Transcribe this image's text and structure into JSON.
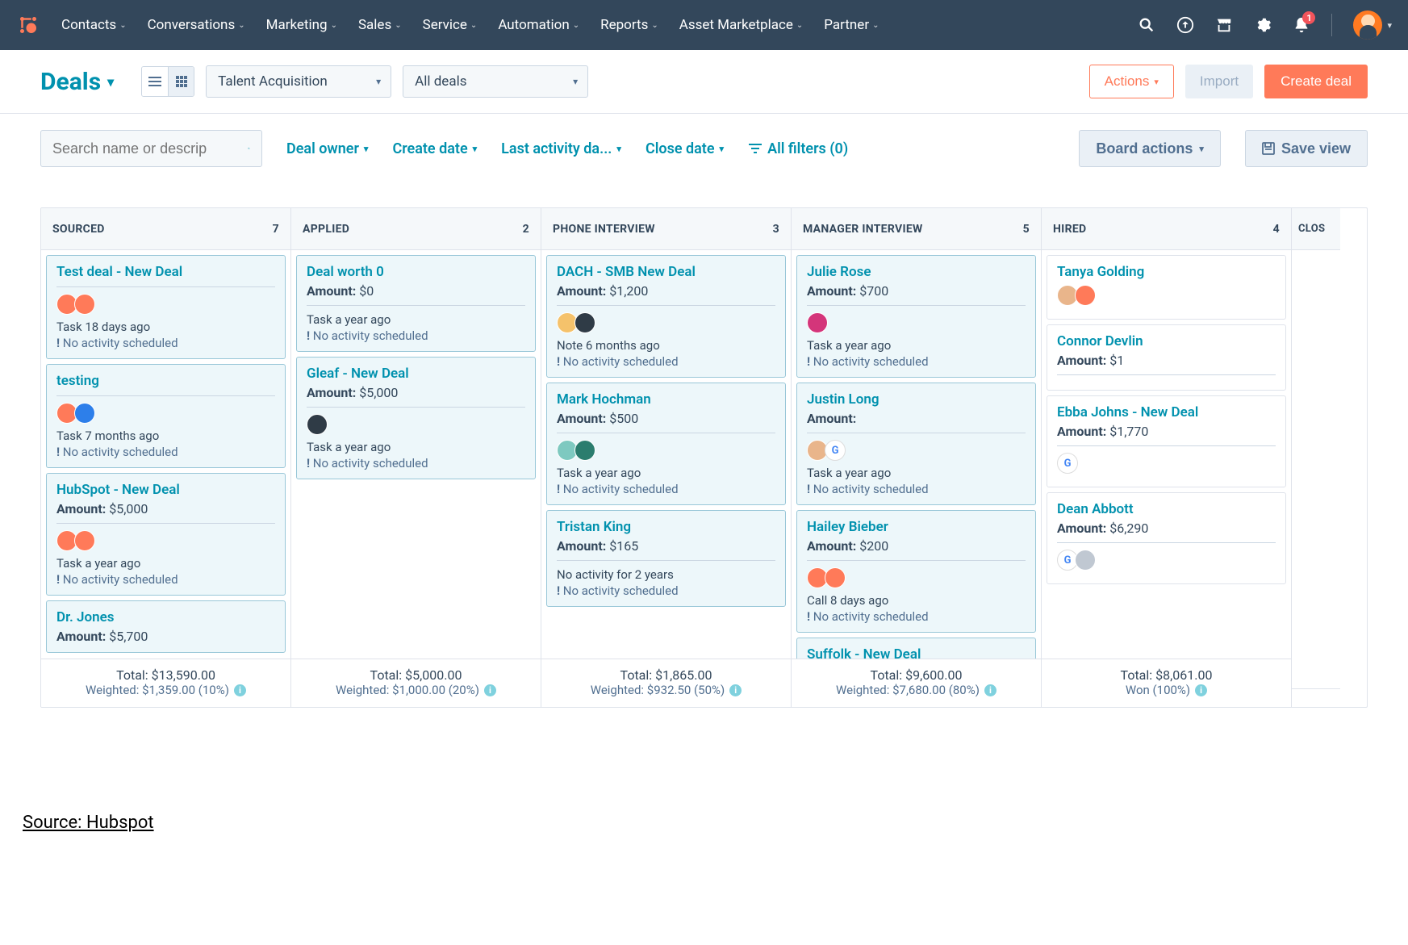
{
  "nav": {
    "items": [
      "Contacts",
      "Conversations",
      "Marketing",
      "Sales",
      "Service",
      "Automation",
      "Reports",
      "Asset Marketplace",
      "Partner"
    ],
    "notif_count": "1"
  },
  "header": {
    "title": "Deals",
    "pipeline_select": "Talent Acquisition",
    "view_select": "All deals",
    "actions_label": "Actions",
    "import_label": "Import",
    "create_label": "Create deal"
  },
  "filters": {
    "search_placeholder": "Search name or descrip",
    "owner": "Deal owner",
    "create": "Create date",
    "last": "Last activity da...",
    "close": "Close date",
    "all": "All filters (0)",
    "board_actions": "Board actions",
    "save_view": "Save view"
  },
  "columns": [
    {
      "name": "SOURCED",
      "count": "7",
      "total": "Total: $13,590.00",
      "weighted": "Weighted: $1,359.00 (10%)",
      "cards": [
        {
          "style": "blue",
          "title": "Test deal - New Deal",
          "amount": null,
          "avatars": [
            "orange",
            "orange"
          ],
          "hr_after_title": true,
          "meta": "Task 18 days ago",
          "warn": "No activity scheduled"
        },
        {
          "style": "blue",
          "title": "testing",
          "amount": null,
          "avatars": [
            "orange",
            "blue"
          ],
          "hr_after_title": true,
          "meta": "Task 7 months ago",
          "warn": "No activity scheduled"
        },
        {
          "style": "blue",
          "title": "HubSpot - New Deal",
          "amount_label": "Amount:",
          "amount": "$5,000",
          "avatars": [
            "orange",
            "orange"
          ],
          "hr": true,
          "meta": "Task a year ago",
          "warn": "No activity scheduled"
        },
        {
          "style": "blue",
          "title": "Dr. Jones",
          "amount_label": "Amount:",
          "amount": "$5,700"
        }
      ]
    },
    {
      "name": "APPLIED",
      "count": "2",
      "total": "Total: $5,000.00",
      "weighted": "Weighted: $1,000.00 (20%)",
      "cards": [
        {
          "style": "blue",
          "title": "Deal worth 0",
          "amount_label": "Amount:",
          "amount": "$0",
          "hr": true,
          "meta": "Task a year ago",
          "warn": "No activity scheduled"
        },
        {
          "style": "blue",
          "title": "Gleaf - New Deal",
          "amount_label": "Amount:",
          "amount": "$5,000",
          "avatars": [
            "dark"
          ],
          "hr": true,
          "meta": "Task a year ago",
          "warn": "No activity scheduled"
        }
      ]
    },
    {
      "name": "PHONE INTERVIEW",
      "count": "3",
      "total": "Total: $1,865.00",
      "weighted": "Weighted: $932.50 (50%)",
      "cards": [
        {
          "style": "blue",
          "title": "DACH - SMB New Deal",
          "amount_label": "Amount:",
          "amount": "$1,200",
          "avatars": [
            "yellow",
            "dark"
          ],
          "hr": true,
          "meta": "Note 6 months ago",
          "warn": "No activity scheduled"
        },
        {
          "style": "blue",
          "title": "Mark Hochman",
          "amount_label": "Amount:",
          "amount": "$500",
          "avatars": [
            "mint",
            "teal"
          ],
          "hr": true,
          "meta": "Task a year ago",
          "warn": "No activity scheduled"
        },
        {
          "style": "blue",
          "title": "Tristan King",
          "amount_label": "Amount:",
          "amount": "$165",
          "hr": true,
          "meta": "No activity for 2 years",
          "warn": "No activity scheduled"
        }
      ]
    },
    {
      "name": "MANAGER INTERVIEW",
      "count": "5",
      "total": "Total: $9,600.00",
      "weighted": "Weighted: $7,680.00 (80%)",
      "cards": [
        {
          "style": "blue",
          "title": "Julie Rose",
          "amount_label": "Amount:",
          "amount": "$700",
          "avatars": [
            "pink"
          ],
          "hr": true,
          "meta": "Task a year ago",
          "warn": "No activity scheduled"
        },
        {
          "style": "blue",
          "title": "Justin Long",
          "amount_label": "Amount:",
          "amount": null,
          "avatars": [
            "skin",
            "google"
          ],
          "hr": true,
          "meta": "Task a year ago",
          "warn": "No activity scheduled"
        },
        {
          "style": "blue",
          "title": "Hailey Bieber",
          "amount_label": "Amount:",
          "amount": "$200",
          "avatars": [
            "orange",
            "orange"
          ],
          "hr": true,
          "meta": "Call 8 days ago",
          "warn": "No activity scheduled"
        },
        {
          "style": "blue",
          "title": "Suffolk - New Deal"
        }
      ]
    },
    {
      "name": "HIRED",
      "count": "4",
      "total": "Total: $8,061.00",
      "weighted": "Won (100%)",
      "cards": [
        {
          "style": "white",
          "title": "Tanya Golding",
          "avatars": [
            "skin",
            "orange"
          ]
        },
        {
          "style": "white",
          "title": "Connor Devlin",
          "amount_label": "Amount:",
          "amount": "$1",
          "hr": true
        },
        {
          "style": "white",
          "title": "Ebba Johns - New Deal",
          "amount_label": "Amount:",
          "amount": "$1,770",
          "avatars": [
            "google"
          ],
          "hr": true
        },
        {
          "style": "white",
          "title": "Dean Abbott",
          "amount_label": "Amount:",
          "amount": "$6,290",
          "avatars": [
            "google",
            "grey"
          ],
          "hr": true
        }
      ]
    }
  ],
  "extra_col": "CLOS",
  "source_note": "Source: Hubspot"
}
